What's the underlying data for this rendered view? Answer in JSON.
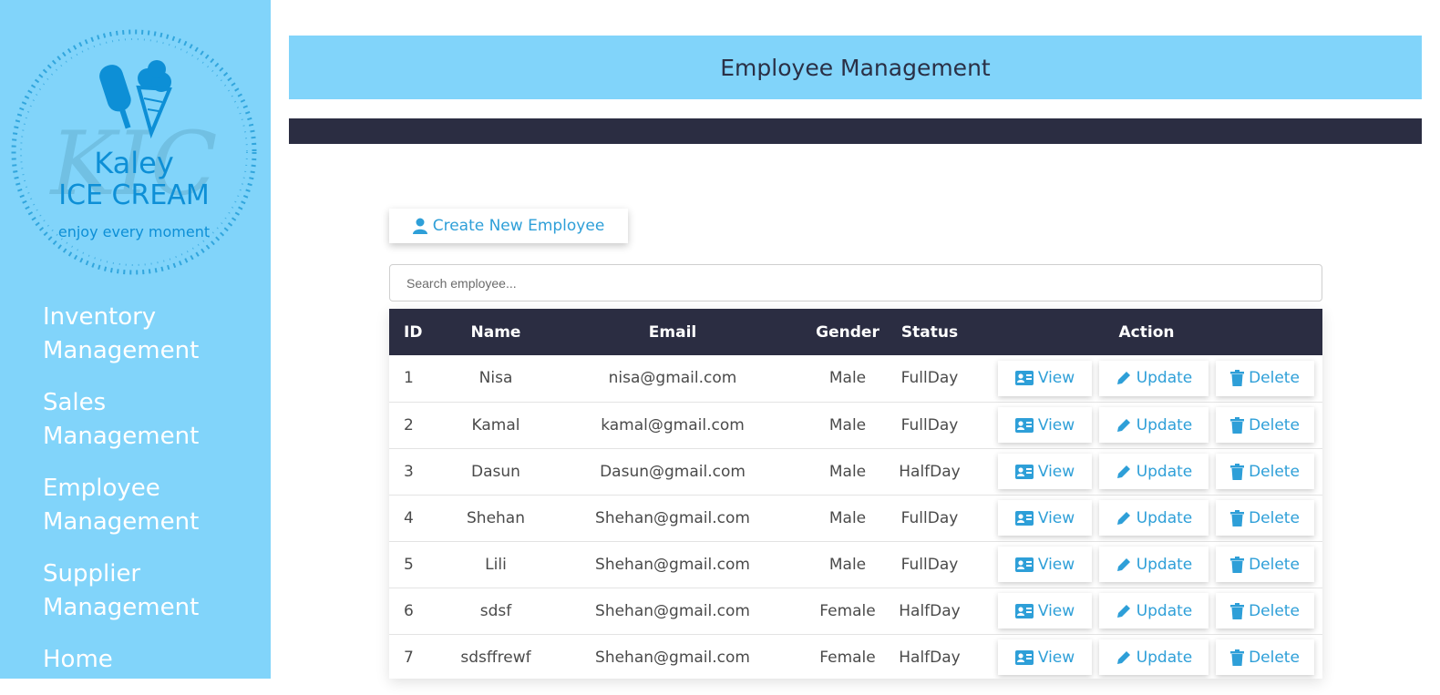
{
  "brand": {
    "name_line1": "Kaley",
    "name_line2": "ICE CREAM",
    "tagline": "enjoy every moment",
    "watermark": "KIC"
  },
  "sidebar": {
    "items": [
      {
        "label": "Inventory Management"
      },
      {
        "label": "Sales Management"
      },
      {
        "label": "Employee Management"
      },
      {
        "label": "Supplier Management"
      },
      {
        "label": "Home"
      }
    ]
  },
  "header": {
    "title": "Employee Management"
  },
  "toolbar": {
    "create_label": "Create New Employee"
  },
  "search": {
    "placeholder": "Search employee...",
    "value": ""
  },
  "table": {
    "columns": [
      "ID",
      "Name",
      "Email",
      "Gender",
      "Status",
      "Action"
    ],
    "rows": [
      {
        "id": "1",
        "name": "Nisa",
        "email": "nisa@gmail.com",
        "gender": "Male",
        "status": "FullDay"
      },
      {
        "id": "2",
        "name": "Kamal",
        "email": "kamal@gmail.com",
        "gender": "Male",
        "status": "FullDay"
      },
      {
        "id": "3",
        "name": "Dasun",
        "email": "Dasun@gmail.com",
        "gender": "Male",
        "status": "HalfDay"
      },
      {
        "id": "4",
        "name": "Shehan",
        "email": "Shehan@gmail.com",
        "gender": "Male",
        "status": "FullDay"
      },
      {
        "id": "5",
        "name": "Lili",
        "email": "Shehan@gmail.com",
        "gender": "Male",
        "status": "FullDay"
      },
      {
        "id": "6",
        "name": "sdsf",
        "email": "Shehan@gmail.com",
        "gender": "Female",
        "status": "HalfDay"
      },
      {
        "id": "7",
        "name": "sdsffrewf",
        "email": "Shehan@gmail.com",
        "gender": "Female",
        "status": "HalfDay"
      }
    ],
    "actions": {
      "view": "View",
      "update": "Update",
      "delete": "Delete"
    }
  },
  "colors": {
    "sidebar_bg": "#81d4fa",
    "header_bg": "#81d4fa",
    "dark": "#2b2d42",
    "accent": "#2e9fd8",
    "logo_blue": "#0d8fd6"
  },
  "icons": {
    "create": "user-icon",
    "view": "id-card-icon",
    "update": "pencil-icon",
    "delete": "trash-icon"
  }
}
